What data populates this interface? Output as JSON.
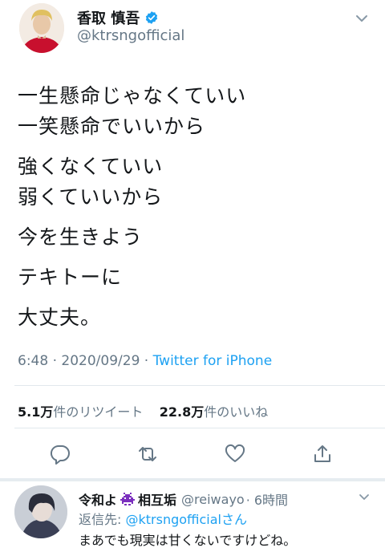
{
  "author": {
    "display_name": "香取 慎吾",
    "handle": "@ktrsngofficial"
  },
  "tweet": {
    "lines": [
      "一生懸命じゃなくていい",
      "一笑懸命でいいから",
      "強くなくていい",
      "弱くていいから",
      "今を生きよう",
      "テキトーに",
      "大丈夫。"
    ],
    "time": "6:48",
    "date": "2020/09/29",
    "separator": "·",
    "source": "Twitter for iPhone",
    "retweets_value": "5.1万",
    "retweets_label": "件のリツイート",
    "likes_value": "22.8万",
    "likes_label": "件のいいね"
  },
  "actions": [
    {
      "icon": "reply-icon"
    },
    {
      "icon": "retweet-icon"
    },
    {
      "icon": "like-icon"
    },
    {
      "icon": "share-icon"
    }
  ],
  "reply": {
    "name_part1": "令和よ",
    "name_part2": "相互垢",
    "handle": "@reiwayo",
    "time": "· 6時間",
    "reply_to_label": "返信先:",
    "reply_to_handle": "@ktrsngofficialさん",
    "text": "まあでも現実は甘くないですけどね。"
  },
  "colors": {
    "link": "#1da1f2",
    "secondary_text": "#657786",
    "divider": "#e1e8ed"
  }
}
